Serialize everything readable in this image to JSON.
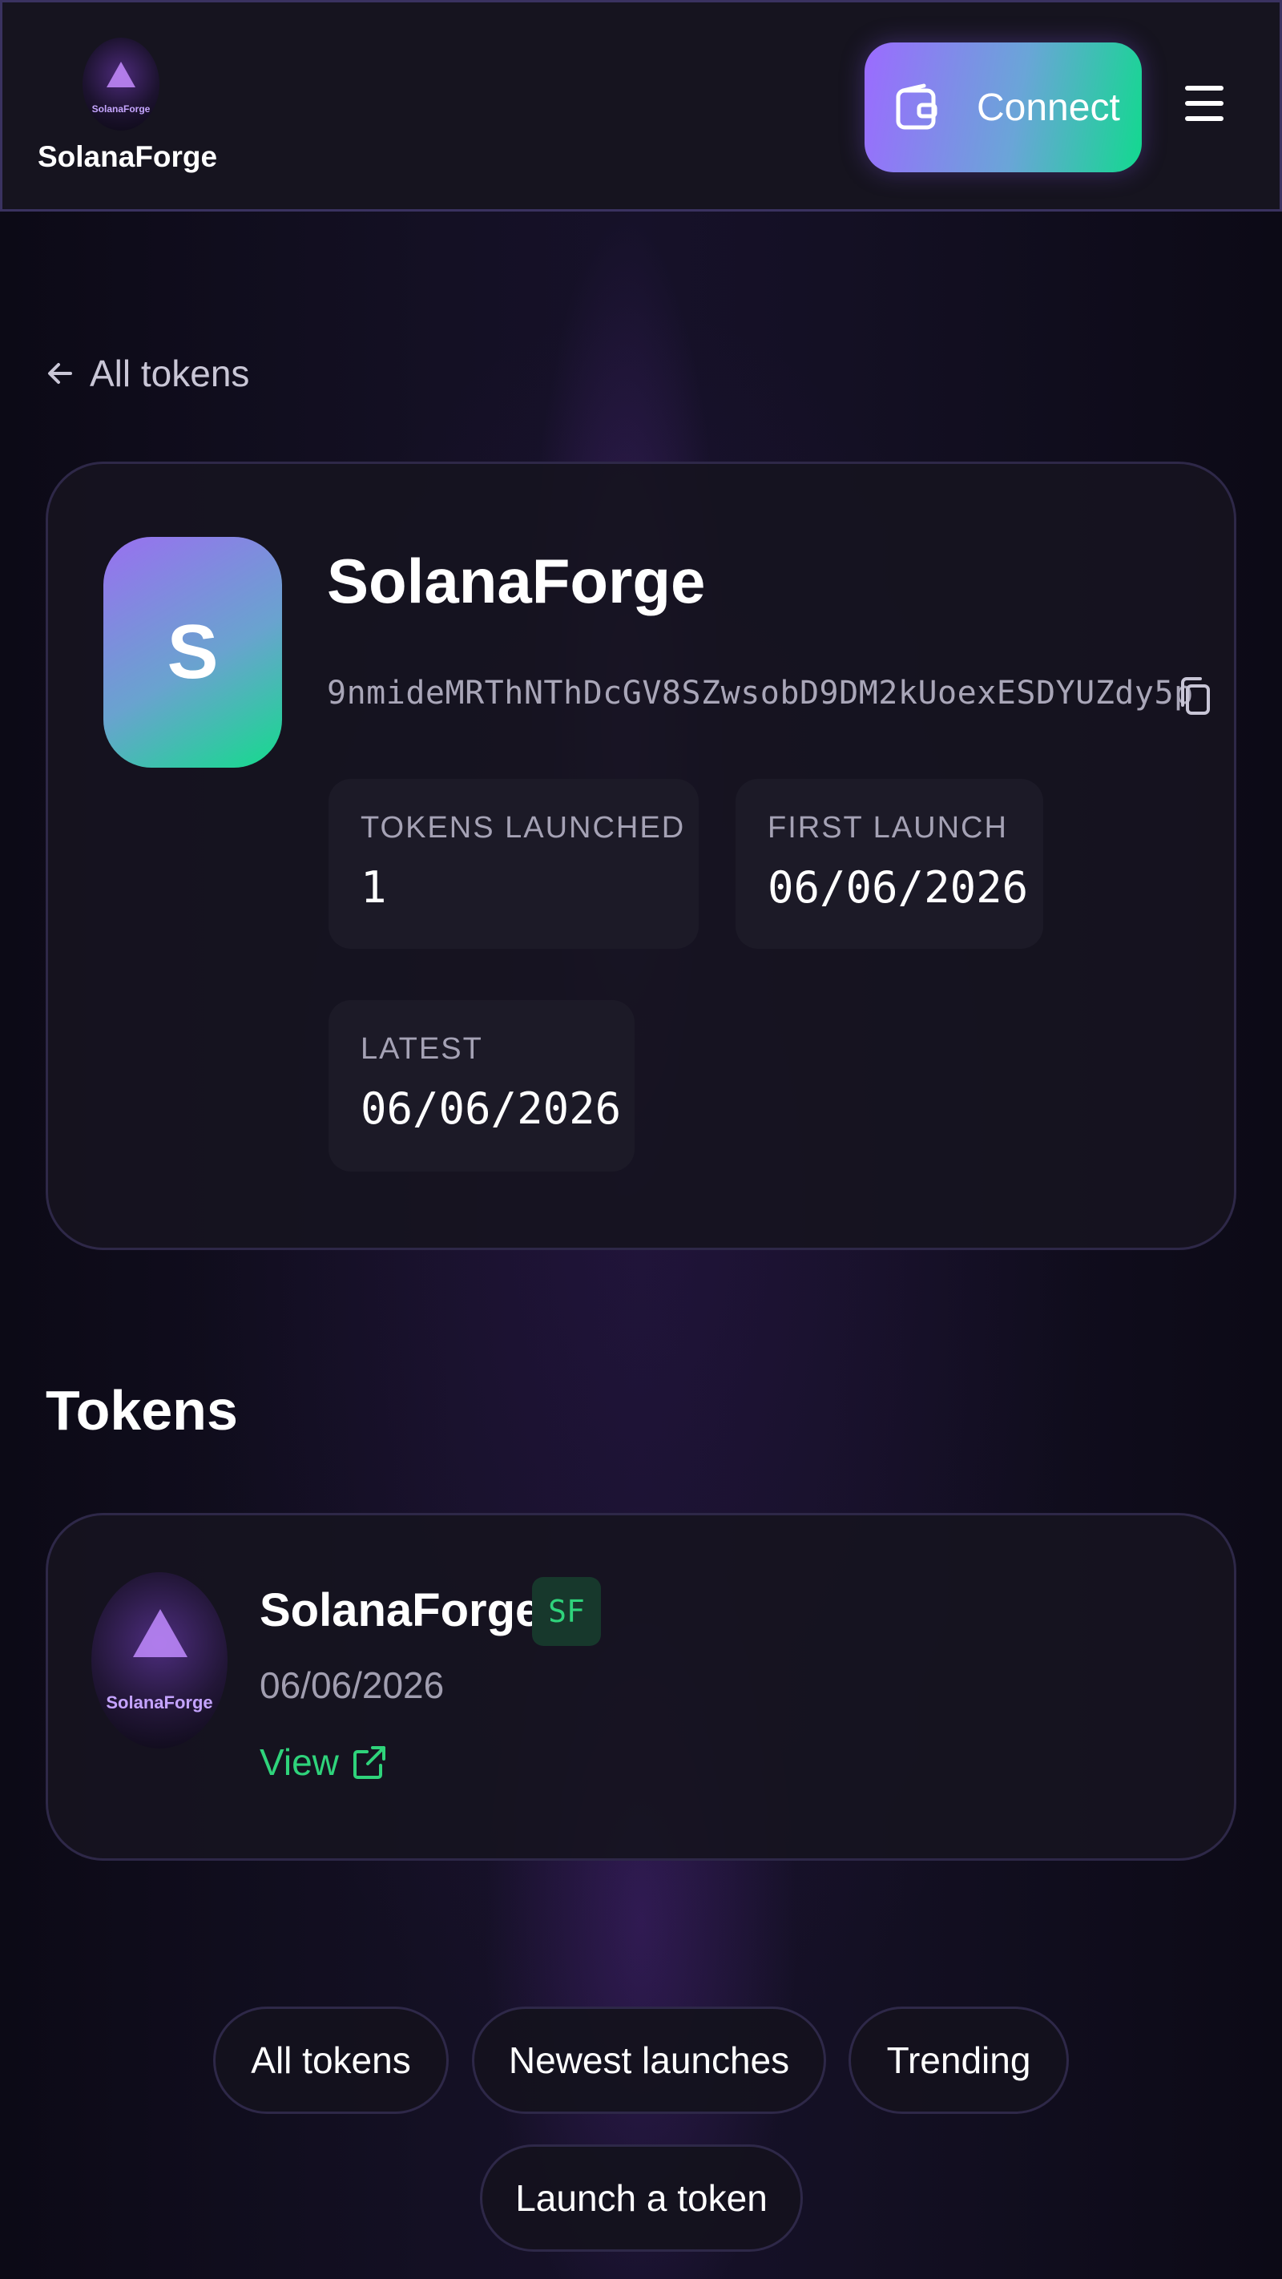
{
  "header": {
    "brand_name": "SolanaForge",
    "logo_text": "SolanaForge",
    "connect_label": "Connect",
    "icons": {
      "wallet": "wallet-icon",
      "menu": "hamburger-menu-icon"
    },
    "colors": {
      "connect_gradient_start": "#9b6bff",
      "connect_gradient_end": "#12d98f"
    }
  },
  "back_link": {
    "label": "All tokens",
    "icon": "arrow-left-icon"
  },
  "profile": {
    "avatar_letter": "S",
    "name": "SolanaForge",
    "address": "9nmideMRThNThDcGV8SZwsobD9DM2kUoexESDYUZdy5p",
    "stats": [
      {
        "label": "TOKENS LAUNCHED",
        "value": "1"
      },
      {
        "label": "FIRST LAUNCH",
        "value": "06/06/2026"
      },
      {
        "label": "LATEST",
        "value": "06/06/2026"
      }
    ]
  },
  "tokens_section": {
    "title": "Tokens",
    "items": [
      {
        "name": "SolanaForge",
        "symbol": "SF",
        "date": "06/06/2026",
        "view_label": "View",
        "image_text": "SolanaForge"
      }
    ]
  },
  "footer_nav": {
    "all_tokens": "All tokens",
    "newest": "Newest launches",
    "trending": "Trending",
    "launch": "Launch a token"
  },
  "colors": {
    "background": "#0d0b18",
    "accent_green": "#2fd37b",
    "accent_purple": "#9b6bff"
  }
}
